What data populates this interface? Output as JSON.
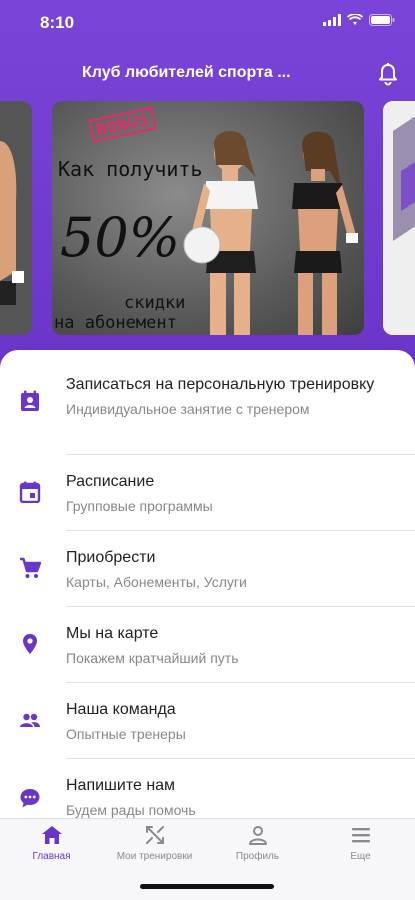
{
  "status_bar": {
    "time": "8:10"
  },
  "header": {
    "title": "Клуб любителей спорта ...",
    "notification_icon": "bell-icon"
  },
  "carousel": {
    "promo": {
      "badge": "BONUS",
      "title": "Как получить",
      "percent": "50%",
      "line1": "скидки",
      "line2": "на абонемент"
    }
  },
  "menu": {
    "items": [
      {
        "label": "Записаться на персональную тренировку",
        "sub": "Индивидуальное занятие с тренером",
        "icon": "person-calendar-icon"
      },
      {
        "label": "Расписание",
        "sub": "Групповые программы",
        "icon": "calendar-icon"
      },
      {
        "label": "Приобрести",
        "sub": "Карты, Абонементы, Услуги",
        "icon": "cart-icon"
      },
      {
        "label": "Мы на карте",
        "sub": "Покажем кратчайший путь",
        "icon": "map-pin-icon"
      },
      {
        "label": "Наша команда",
        "sub": "Опытные тренеры",
        "icon": "team-icon"
      },
      {
        "label": "Напишите нам",
        "sub": "Будем рады помочь",
        "icon": "chat-icon"
      }
    ]
  },
  "tabbar": {
    "tabs": [
      {
        "label": "Главная",
        "icon": "home-icon",
        "active": true
      },
      {
        "label": "Мои тренировки",
        "icon": "workouts-icon",
        "active": false
      },
      {
        "label": "Профиль",
        "icon": "profile-icon",
        "active": false
      },
      {
        "label": "Еще",
        "icon": "menu-icon",
        "active": false
      }
    ]
  },
  "colors": {
    "accent": "#6a36c9",
    "header_bg": "#7a44d8",
    "text_primary": "#222222",
    "text_secondary": "#888888"
  }
}
